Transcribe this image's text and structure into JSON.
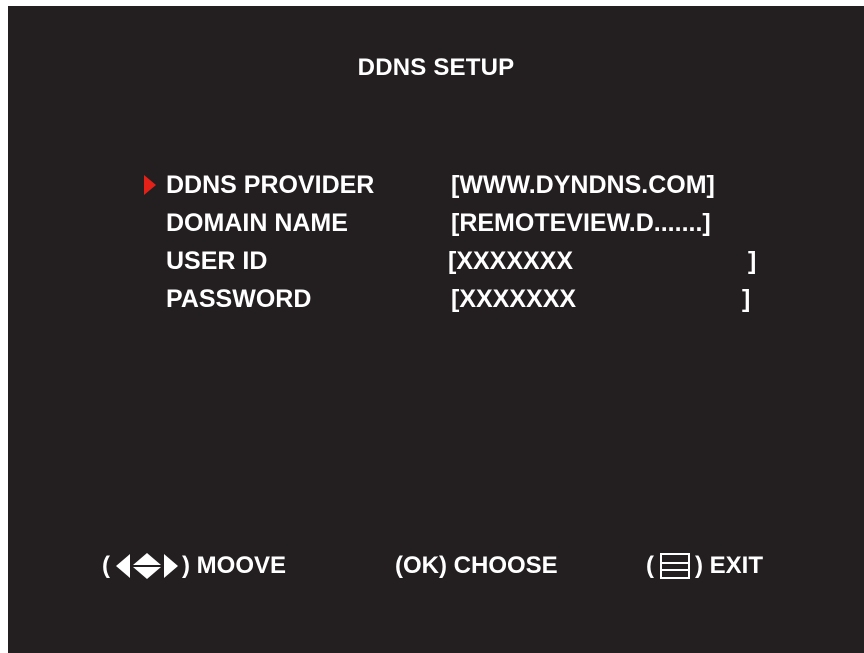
{
  "screen": {
    "title": "DDNS SETUP",
    "background_color": "#231f20",
    "text_color": "#ffffff",
    "cursor_color": "#e32119"
  },
  "menu": {
    "selected_index": 0,
    "items": [
      {
        "label": "DDNS PROVIDER",
        "value": "[WWW.DYNDNS.COM]",
        "close": ""
      },
      {
        "label": "DOMAIN NAME",
        "value": "[REMOTEVIEW.D.......]",
        "close": ""
      },
      {
        "label": "USER ID",
        "value": "[XXXXXXX",
        "close": "]"
      },
      {
        "label": "PASSWORD",
        "value": "[XXXXXXX",
        "close": "]"
      }
    ]
  },
  "footer": {
    "move": {
      "open": "(",
      "close": ") MOOVE",
      "icon": "arrow-keys-icon"
    },
    "choose": {
      "label": "(OK) CHOOSE"
    },
    "exit": {
      "open": "(",
      "close": ") EXIT",
      "icon": "menu-icon"
    }
  }
}
